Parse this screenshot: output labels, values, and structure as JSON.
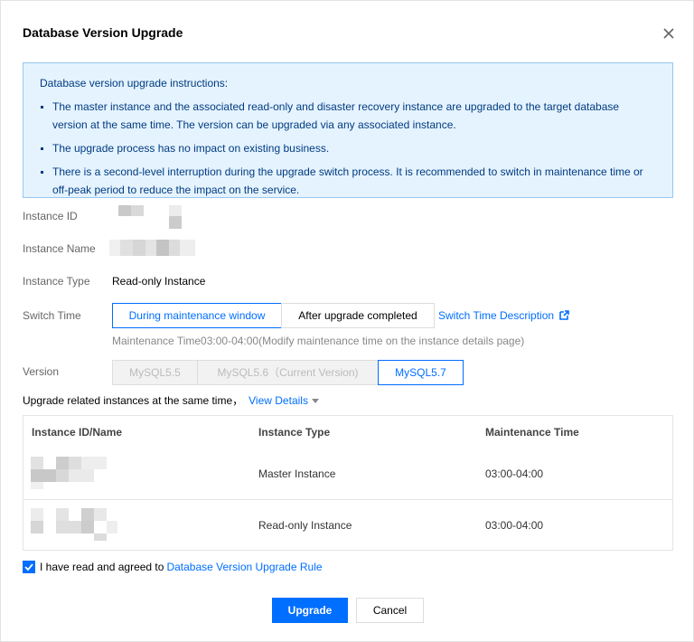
{
  "dialog": {
    "title": "Database Version Upgrade"
  },
  "notice": {
    "heading": "Database version upgrade instructions:",
    "items": [
      "The master instance and the associated read-only and disaster recovery instance are upgraded to the target database version at the same time. The version can be upgraded via any associated instance.",
      "The upgrade process has no impact on existing business.",
      "There is a second-level interruption during the upgrade switch process. It is recommended to switch in maintenance time or off-peak period to reduce the impact on the service."
    ]
  },
  "form": {
    "instance_id_label": "Instance ID",
    "instance_name_label": "Instance Name",
    "instance_type_label": "Instance Type",
    "instance_type_value": "Read-only Instance",
    "switch_time_label": "Switch Time",
    "switch_options": [
      "During maintenance window",
      "After upgrade completed"
    ],
    "switch_selected": "During maintenance window",
    "switch_time_desc_link": "Switch Time Description",
    "maintenance_hint": "Maintenance Time03:00-04:00(Modify maintenance time on the instance details page)",
    "version_label": "Version",
    "versions": [
      "MySQL5.5",
      "MySQL5.6（Current Version)",
      "MySQL5.7"
    ],
    "version_selected": "MySQL5.7"
  },
  "related": {
    "text": "Upgrade related instances at the same time，",
    "view_details": "View Details"
  },
  "table": {
    "columns": [
      "Instance ID/Name",
      "Instance Type",
      "Maintenance Time"
    ],
    "rows": [
      {
        "type": "Master Instance",
        "time": "03:00-04:00"
      },
      {
        "type": "Read-only Instance",
        "time": "03:00-04:00"
      }
    ]
  },
  "agreement": {
    "checked": true,
    "text": "I have read and agreed to ",
    "link": "Database Version Upgrade Rule"
  },
  "buttons": {
    "upgrade": "Upgrade",
    "cancel": "Cancel"
  },
  "colors": {
    "accent": "#006eff",
    "notice_bg": "#e5f3ff",
    "notice_border": "#97c7f1",
    "notice_text": "#003b80"
  }
}
